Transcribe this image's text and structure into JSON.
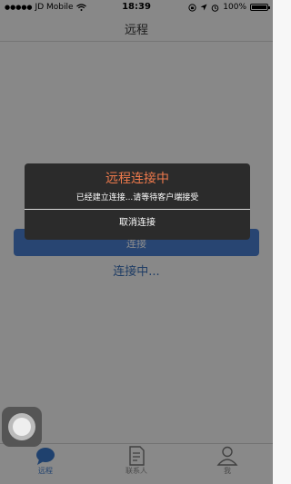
{
  "status_bar": {
    "signal_dots": "●●●●●",
    "carrier": "JD Mobile",
    "time": "18:39",
    "battery_text": "100%",
    "battery_level": 1.0
  },
  "nav": {
    "title": "远程"
  },
  "main": {
    "connect_button_label": "连接",
    "connecting_status": "连接中..."
  },
  "tab_bar": {
    "tabs": [
      {
        "label": "远程",
        "icon": "chat-bubble-icon",
        "active": true
      },
      {
        "label": "联系人",
        "icon": "contacts-icon",
        "active": false
      },
      {
        "label": "我",
        "icon": "person-icon",
        "active": false
      }
    ]
  },
  "dialog": {
    "title": "远程连接中",
    "message": "已经建立连接...请等待客户端接受",
    "cancel_label": "取消连接"
  },
  "colors": {
    "accent": "#3a77c8",
    "dialog_title": "#ef7a4c",
    "dialog_bg": "#2b2b2b"
  }
}
